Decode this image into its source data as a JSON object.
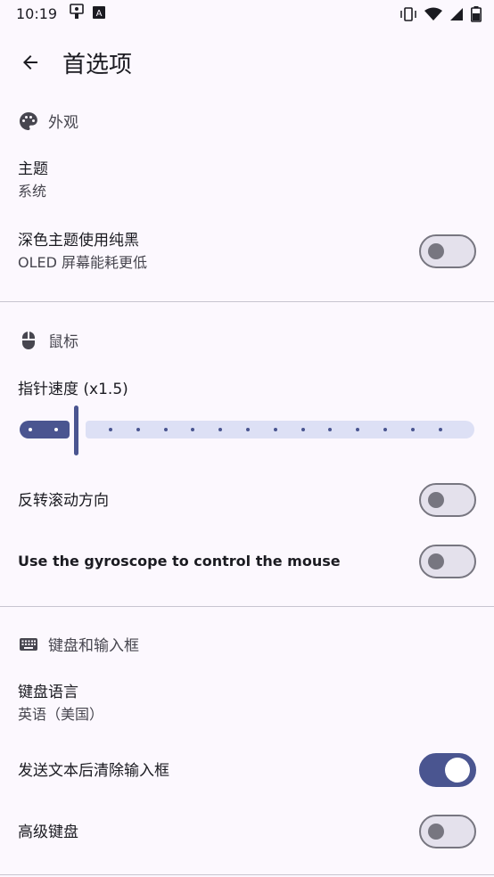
{
  "status": {
    "time": "10:19"
  },
  "appbar": {
    "title": "首选项"
  },
  "sections": {
    "appearance": {
      "header": "外观",
      "theme": {
        "title": "主题",
        "summary": "系统"
      },
      "dark_black": {
        "title": "深色主题使用纯黑",
        "summary": "OLED 屏幕能耗更低",
        "enabled": false
      }
    },
    "mouse": {
      "header": "鼠标",
      "pointer_speed": {
        "title": "指针速度 (x1.5)",
        "value": 1.5
      },
      "invert_scroll": {
        "title": "反转滚动方向",
        "enabled": false
      },
      "gyroscope": {
        "title": "Use the gyroscope to control the mouse",
        "enabled": false
      }
    },
    "keyboard": {
      "header": "键盘和输入框",
      "language": {
        "title": "键盘语言",
        "summary": "英语（美国）"
      },
      "clear_after_send": {
        "title": "发送文本后清除输入框",
        "enabled": true
      },
      "advanced": {
        "title": "高级键盘",
        "enabled": false
      }
    }
  },
  "colors": {
    "accent": "#4a5590",
    "track_inactive": "#dde0f5",
    "background": "#fcf8fe"
  }
}
